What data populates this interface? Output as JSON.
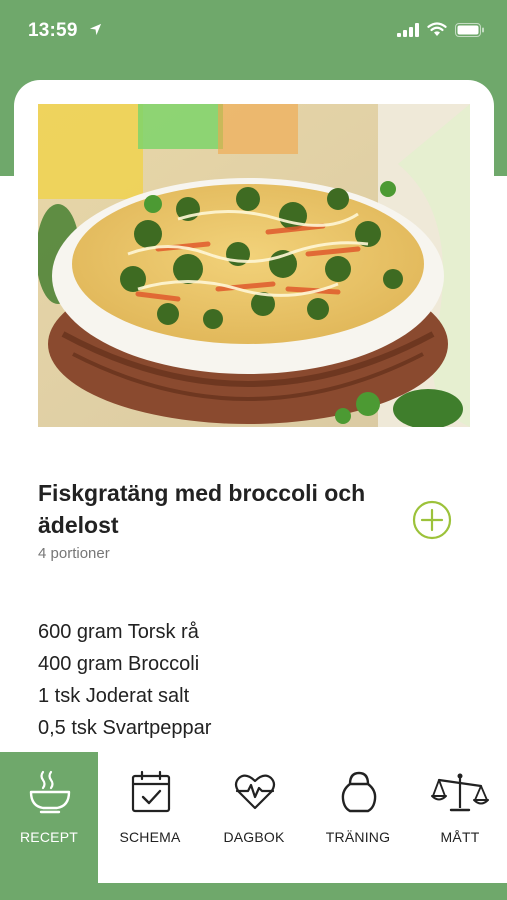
{
  "status_bar": {
    "time": "13:59",
    "icons": [
      "location-arrow-icon",
      "cellular-signal-icon",
      "wifi-icon",
      "battery-icon"
    ]
  },
  "recipe": {
    "title": "Fiskgratäng med broccoli och ädelost",
    "servings": "4 portioner",
    "image": "broccoli-fish-gratin-photo",
    "ingredients": [
      "600 gram Torsk rå",
      "400 gram Broccoli",
      "1 tsk Joderat salt",
      "0,5 tsk Svartpeppar"
    ]
  },
  "tabs": [
    {
      "label": "RECEPT",
      "icon": "bowl-icon",
      "active": true
    },
    {
      "label": "SCHEMA",
      "icon": "calendar-check-icon",
      "active": false
    },
    {
      "label": "DAGBOK",
      "icon": "heart-pulse-icon",
      "active": false
    },
    {
      "label": "TRÄNING",
      "icon": "kettlebell-icon",
      "active": false
    },
    {
      "label": "MÅTT",
      "icon": "scale-icon",
      "active": false
    }
  ],
  "colors": {
    "brand_green": "#6fa86b",
    "add_button": "#9cc23a",
    "text": "#222222",
    "muted": "#777777"
  }
}
